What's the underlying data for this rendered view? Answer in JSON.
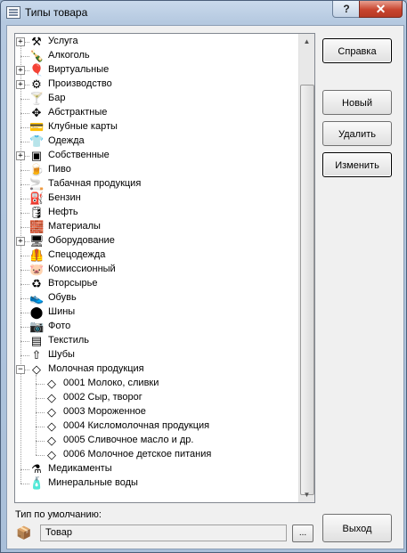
{
  "window": {
    "title": "Типы товара",
    "help_label": "?",
    "close_label": "✕"
  },
  "tree": {
    "items": [
      {
        "label": "Услуга",
        "icon": "⚒",
        "icon_name": "hammer-icon",
        "level": 0,
        "expander": "+"
      },
      {
        "label": "Алкоголь",
        "icon": "🍾",
        "icon_name": "bottle-icon",
        "level": 0,
        "expander": ""
      },
      {
        "label": "Виртуальные",
        "icon": "🎈",
        "icon_name": "balloon-icon",
        "level": 0,
        "expander": "+"
      },
      {
        "label": "Производство",
        "icon": "⚙",
        "icon_name": "gears-icon",
        "level": 0,
        "expander": "+"
      },
      {
        "label": "Бар",
        "icon": "🍸",
        "icon_name": "bar-icon",
        "level": 0,
        "expander": ""
      },
      {
        "label": "Абстрактные",
        "icon": "✥",
        "icon_name": "abstract-icon",
        "level": 0,
        "expander": ""
      },
      {
        "label": "Клубные карты",
        "icon": "💳",
        "icon_name": "card-icon",
        "level": 0,
        "expander": ""
      },
      {
        "label": "Одежда",
        "icon": "👕",
        "icon_name": "shirt-icon",
        "level": 0,
        "expander": ""
      },
      {
        "label": "Собственные",
        "icon": "▣",
        "icon_name": "own-icon",
        "level": 0,
        "expander": "+"
      },
      {
        "label": "Пиво",
        "icon": "🍺",
        "icon_name": "beer-icon",
        "level": 0,
        "expander": ""
      },
      {
        "label": "Табачная продукция",
        "icon": "🚬",
        "icon_name": "cigarette-icon",
        "level": 0,
        "expander": ""
      },
      {
        "label": "Бензин",
        "icon": "⛽",
        "icon_name": "fuel-icon",
        "level": 0,
        "expander": ""
      },
      {
        "label": "Нефть",
        "icon": "🛢",
        "icon_name": "oil-icon",
        "level": 0,
        "expander": ""
      },
      {
        "label": "Материалы",
        "icon": "🧱",
        "icon_name": "materials-icon",
        "level": 0,
        "expander": ""
      },
      {
        "label": "Оборудование",
        "icon": "🖥",
        "icon_name": "equipment-icon",
        "level": 0,
        "expander": "+"
      },
      {
        "label": "Спецодежда",
        "icon": "🦺",
        "icon_name": "workwear-icon",
        "level": 0,
        "expander": ""
      },
      {
        "label": "Комиссионный",
        "icon": "🐷",
        "icon_name": "piggy-icon",
        "level": 0,
        "expander": ""
      },
      {
        "label": "Вторсырье",
        "icon": "♻",
        "icon_name": "recycle-icon",
        "level": 0,
        "expander": ""
      },
      {
        "label": "Обувь",
        "icon": "👟",
        "icon_name": "shoe-icon",
        "level": 0,
        "expander": ""
      },
      {
        "label": "Шины",
        "icon": "⬤",
        "icon_name": "tire-icon",
        "level": 0,
        "expander": ""
      },
      {
        "label": "Фото",
        "icon": "📷",
        "icon_name": "camera-icon",
        "level": 0,
        "expander": ""
      },
      {
        "label": "Текстиль",
        "icon": "▤",
        "icon_name": "textile-icon",
        "level": 0,
        "expander": ""
      },
      {
        "label": "Шубы",
        "icon": "⇧",
        "icon_name": "fur-icon",
        "level": 0,
        "expander": ""
      },
      {
        "label": "Молочная продукция",
        "icon": "◇",
        "icon_name": "dairy-icon",
        "level": 0,
        "expander": "−"
      },
      {
        "label": "0001 Молоко, сливки",
        "icon": "◇",
        "icon_name": "dairy-icon",
        "level": 1,
        "expander": ""
      },
      {
        "label": "0002 Сыр, творог",
        "icon": "◇",
        "icon_name": "dairy-icon",
        "level": 1,
        "expander": ""
      },
      {
        "label": "0003 Мороженное",
        "icon": "◇",
        "icon_name": "dairy-icon",
        "level": 1,
        "expander": ""
      },
      {
        "label": "0004 Кисломолочная продукция",
        "icon": "◇",
        "icon_name": "dairy-icon",
        "level": 1,
        "expander": ""
      },
      {
        "label": "0005 Сливочное масло и др.",
        "icon": "◇",
        "icon_name": "dairy-icon",
        "level": 1,
        "expander": ""
      },
      {
        "label": "0006 Молочное детское питания",
        "icon": "◇",
        "icon_name": "dairy-icon",
        "level": 1,
        "expander": ""
      },
      {
        "label": "Медикаменты",
        "icon": "⚗",
        "icon_name": "medicine-icon",
        "level": 0,
        "expander": ""
      },
      {
        "label": "Минеральные воды",
        "icon": "🧴",
        "icon_name": "water-bottle-icon",
        "level": 0,
        "expander": ""
      }
    ]
  },
  "buttons": {
    "help": "Справка",
    "new": "Новый",
    "delete": "Удалить",
    "edit": "Изменить",
    "exit": "Выход"
  },
  "default_type": {
    "label": "Тип по умолчанию:",
    "value": "Товар",
    "browse": "...",
    "icon": "📦"
  },
  "colors": {
    "selection_focus": "#000000",
    "window_frame": "#b5c9e0",
    "close_button": "#c8452f"
  }
}
